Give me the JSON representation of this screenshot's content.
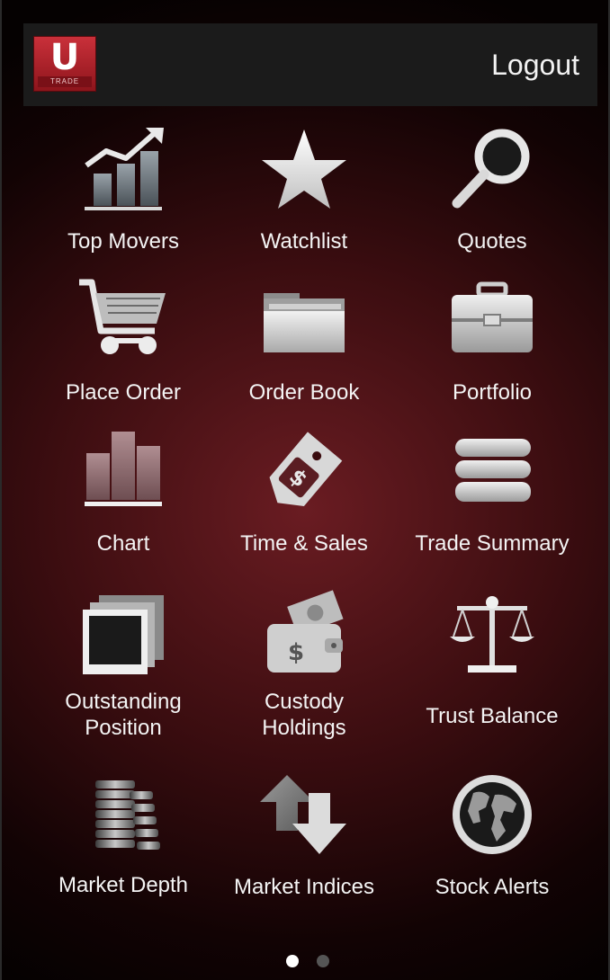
{
  "app": {
    "logo_letter": "U",
    "logo_text": "TRADE",
    "logout_label": "Logout"
  },
  "menu": [
    {
      "label": "Top Movers",
      "icon": "rising-chart-icon"
    },
    {
      "label": "Watchlist",
      "icon": "star-icon"
    },
    {
      "label": "Quotes",
      "icon": "magnifier-icon"
    },
    {
      "label": "Place Order",
      "icon": "shopping-cart-icon"
    },
    {
      "label": "Order Book",
      "icon": "folder-icon"
    },
    {
      "label": "Portfolio",
      "icon": "briefcase-icon"
    },
    {
      "label": "Chart",
      "icon": "bar-chart-icon"
    },
    {
      "label": "Time & Sales",
      "icon": "price-tag-icon"
    },
    {
      "label": "Trade Summary",
      "icon": "database-icon"
    },
    {
      "label": "Outstanding\nPosition",
      "icon": "photo-stack-icon"
    },
    {
      "label": "Custody\nHoldings",
      "icon": "wallet-icon"
    },
    {
      "label": "Trust Balance",
      "icon": "scales-icon"
    },
    {
      "label": "Market Depth",
      "icon": "coin-stack-icon"
    },
    {
      "label": "Market Indices",
      "icon": "up-down-arrows-icon"
    },
    {
      "label": "Stock Alerts",
      "icon": "globe-icon"
    }
  ],
  "pager": {
    "pages": 2,
    "current": 1
  },
  "colors": {
    "accent": "#8e151c",
    "active_dot": "#ffffff",
    "inactive_dot": "#555555"
  }
}
